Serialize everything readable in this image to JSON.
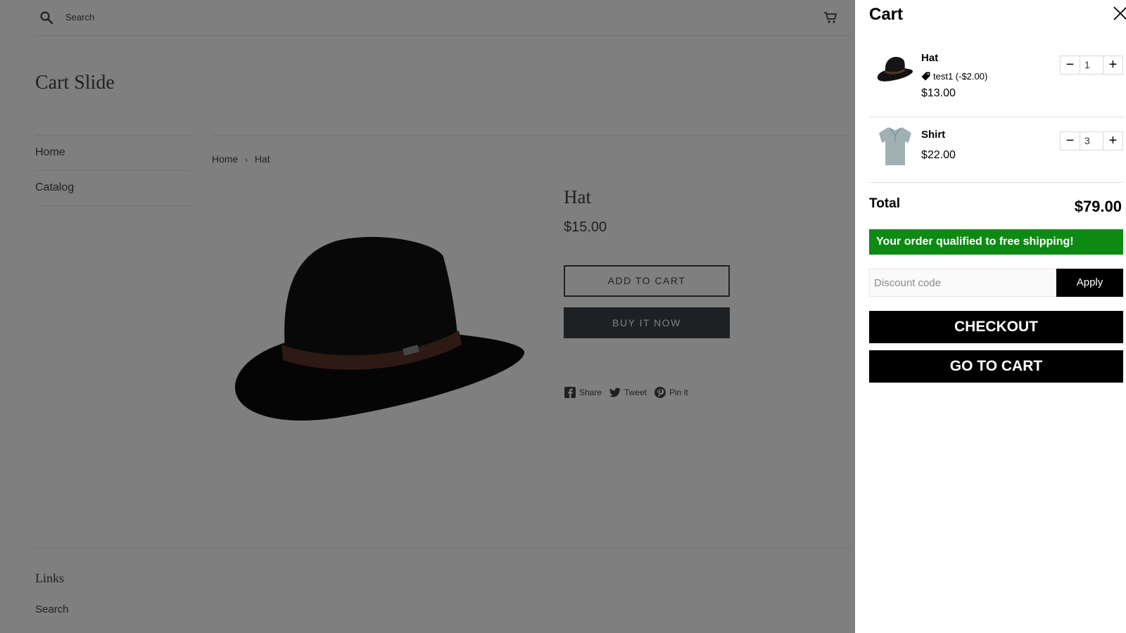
{
  "store": {
    "search_label": "Search",
    "site_title": "Cart Slide",
    "nav": [
      {
        "label": "Home"
      },
      {
        "label": "Catalog"
      }
    ],
    "breadcrumb": {
      "home": "Home",
      "separator": "›",
      "current": "Hat"
    },
    "product": {
      "title": "Hat",
      "price": "$15.00",
      "add_to_cart_label": "ADD TO CART",
      "buy_now_label": "BUY IT NOW"
    },
    "share": [
      {
        "label": "Share",
        "icon": "facebook-icon"
      },
      {
        "label": "Tweet",
        "icon": "twitter-icon"
      },
      {
        "label": "Pin it",
        "icon": "pinterest-icon"
      }
    ],
    "footer": {
      "title": "Links",
      "links": [
        {
          "label": "Search"
        }
      ]
    }
  },
  "cart": {
    "title": "Cart",
    "items": [
      {
        "name": "Hat",
        "discount": "test1 (-$2.00)",
        "price": "$13.00",
        "quantity": "1",
        "thumb_icon": "hat-icon"
      },
      {
        "name": "Shirt",
        "price": "$22.00",
        "quantity": "3",
        "thumb_icon": "shirt-icon"
      }
    ],
    "qty_minus": "−",
    "qty_plus": "+",
    "total_label": "Total",
    "total_value": "$79.00",
    "shipping_message": "Your order qualified to free shipping!",
    "discount_placeholder": "Discount code",
    "apply_label": "Apply",
    "checkout_label": "CHECKOUT",
    "go_to_cart_label": "GO TO CART",
    "colors": {
      "shipping_bar": "#0d8a14",
      "buttons": "#000000"
    }
  }
}
